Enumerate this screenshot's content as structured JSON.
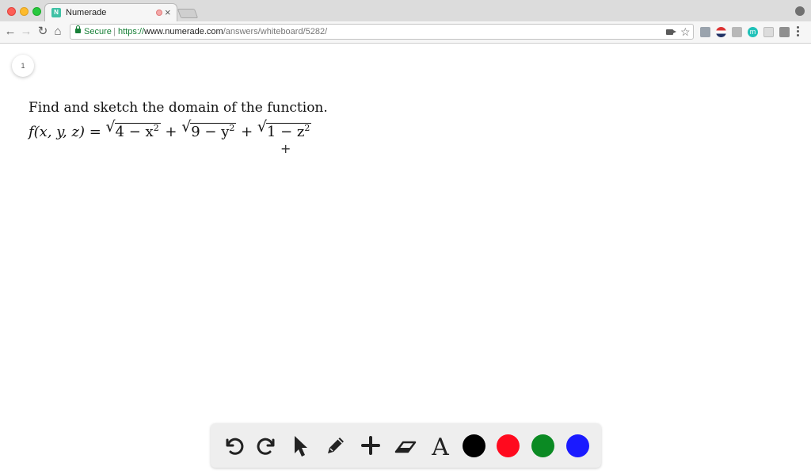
{
  "browser": {
    "tab_title": "Numerade",
    "tab_favicon_letter": "N",
    "secure_label": "Secure",
    "separator": "|",
    "url_scheme": "https://",
    "url_host": "www.numerade.com",
    "url_path": "/answers/whiteboard/5282/",
    "ext_m_letter": "m"
  },
  "whiteboard": {
    "page_number": "1",
    "question_text": "Find and sketch the domain of the function.",
    "formula_lhs": "f(x, y, z) = ",
    "term1": "4 − x",
    "term2": "9 − y",
    "term3": "1 − z",
    "exp": "2",
    "plus": " + "
  },
  "palette": {
    "tools": [
      "undo-icon",
      "redo-icon",
      "pointer-icon",
      "pencil-icon",
      "add-icon",
      "eraser-icon",
      "text-icon"
    ],
    "text_tool_glyph": "A",
    "colors": [
      "#000000",
      "#ff0a1e",
      "#0b8a23",
      "#1a1aff"
    ]
  }
}
